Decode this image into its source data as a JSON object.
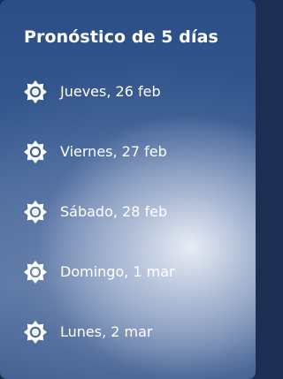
{
  "forecast": {
    "title": "Pronóstico de 5 días",
    "days": [
      {
        "label": "Jueves, 26 feb",
        "icon": "sun-icon"
      },
      {
        "label": "Viernes, 27 feb",
        "icon": "sun-icon"
      },
      {
        "label": "Sábado, 28 feb",
        "icon": "sun-icon"
      },
      {
        "label": "Domingo, 1 mar",
        "icon": "sun-icon"
      },
      {
        "label": "Lunes, 2 mar",
        "icon": "sun-icon"
      }
    ]
  }
}
